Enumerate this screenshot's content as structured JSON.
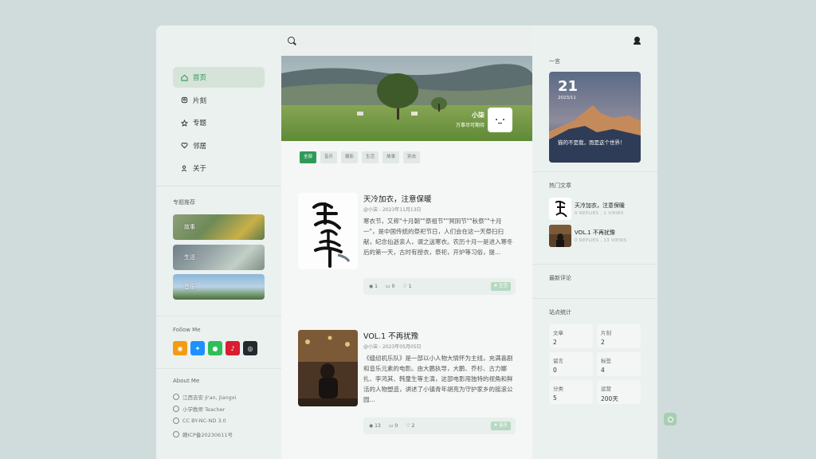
{
  "nav": [
    {
      "label": "首页",
      "icon": "home-icon",
      "active": true
    },
    {
      "label": "片刻",
      "icon": "moment-icon"
    },
    {
      "label": "专题",
      "icon": "star-icon"
    },
    {
      "label": "邻居",
      "icon": "heart-icon"
    },
    {
      "label": "关于",
      "icon": "user-icon"
    }
  ],
  "topics_title": "专题推荐",
  "topics": [
    "故事",
    "生活",
    "音乐"
  ],
  "follow_title": "Follow Me",
  "socials": [
    {
      "icon": "weibo-icon",
      "color": "#f39c12"
    },
    {
      "icon": "qq-icon",
      "color": "#1e90ff"
    },
    {
      "icon": "wechat-icon",
      "color": "#2fbf5a"
    },
    {
      "icon": "netease-music-icon",
      "color": "#d81e2f"
    },
    {
      "icon": "github-icon",
      "color": "#24292e"
    }
  ],
  "about_title": "About Me",
  "about": [
    "江西吉安 Ji'an, Jiangxi",
    "小学教师 Teacher",
    "CC BY-NC-ND 3.0",
    "赣ICP备20230611号"
  ],
  "profile": {
    "name": "小柒",
    "subtitle": "万事尽可期待"
  },
  "tabs": [
    "全部",
    "音乐",
    "摄影",
    "生活",
    "故事",
    "別击"
  ],
  "posts": [
    {
      "title": "天冷加衣，注意保暖",
      "meta": "@小柒 - 2023年11月13日",
      "excerpt": "寒衣节，又称\"十月朝\"\"祭祖节\"\"冥阴节\"\"秋祭\"\"十月一\"，是中国传统的祭祀节日，人们会在这一天祭扫扫献，纪念仙逝亲人，谓之送寒衣。农历十月一是进入寒冬后的第一天，古时有授衣，祭祀，开炉等习俗，提...",
      "views": "1",
      "comments": "0",
      "likes": "1",
      "tag": "# 生活"
    },
    {
      "title": "VOL.1 不再扰豫",
      "meta": "@小柒 - 2023年05月05日",
      "excerpt": "《缝纫机乐队》是一部以小人物大情怀为主线，充满喜剧和音乐元素的电影。由大鹏执导，大鹏、乔杉、古力娜扎、李鸿其、韩童生等主演，这部电影用独特的视角和鲜活的人物塑造，讲述了小镇青年胡亮为守护家乡的摇滚公园...",
      "views": "13",
      "comments": "0",
      "likes": "2",
      "tag": "# 音乐"
    }
  ],
  "right": {
    "daily_title": "一言",
    "day": "21",
    "year_month": "2023/11",
    "quote": "猫的不是我，而是这个世界！",
    "hot_title": "热门文章",
    "hot": [
      {
        "title": "天冷加衣，注意保暖",
        "meta": "0 REPLIES , 1 VIEWS"
      },
      {
        "title": "VOL.1 不再扰豫",
        "meta": "0 REPLIES , 13 VIEWS"
      }
    ],
    "comments_title": "最新评论",
    "stats_title": "站点统计",
    "stats": [
      {
        "label": "文章",
        "value": "2"
      },
      {
        "label": "片刻",
        "value": "2"
      },
      {
        "label": "留言",
        "value": "0"
      },
      {
        "label": "标签",
        "value": "4"
      },
      {
        "label": "分类",
        "value": "5"
      },
      {
        "label": "运营",
        "value": "200天"
      }
    ]
  }
}
